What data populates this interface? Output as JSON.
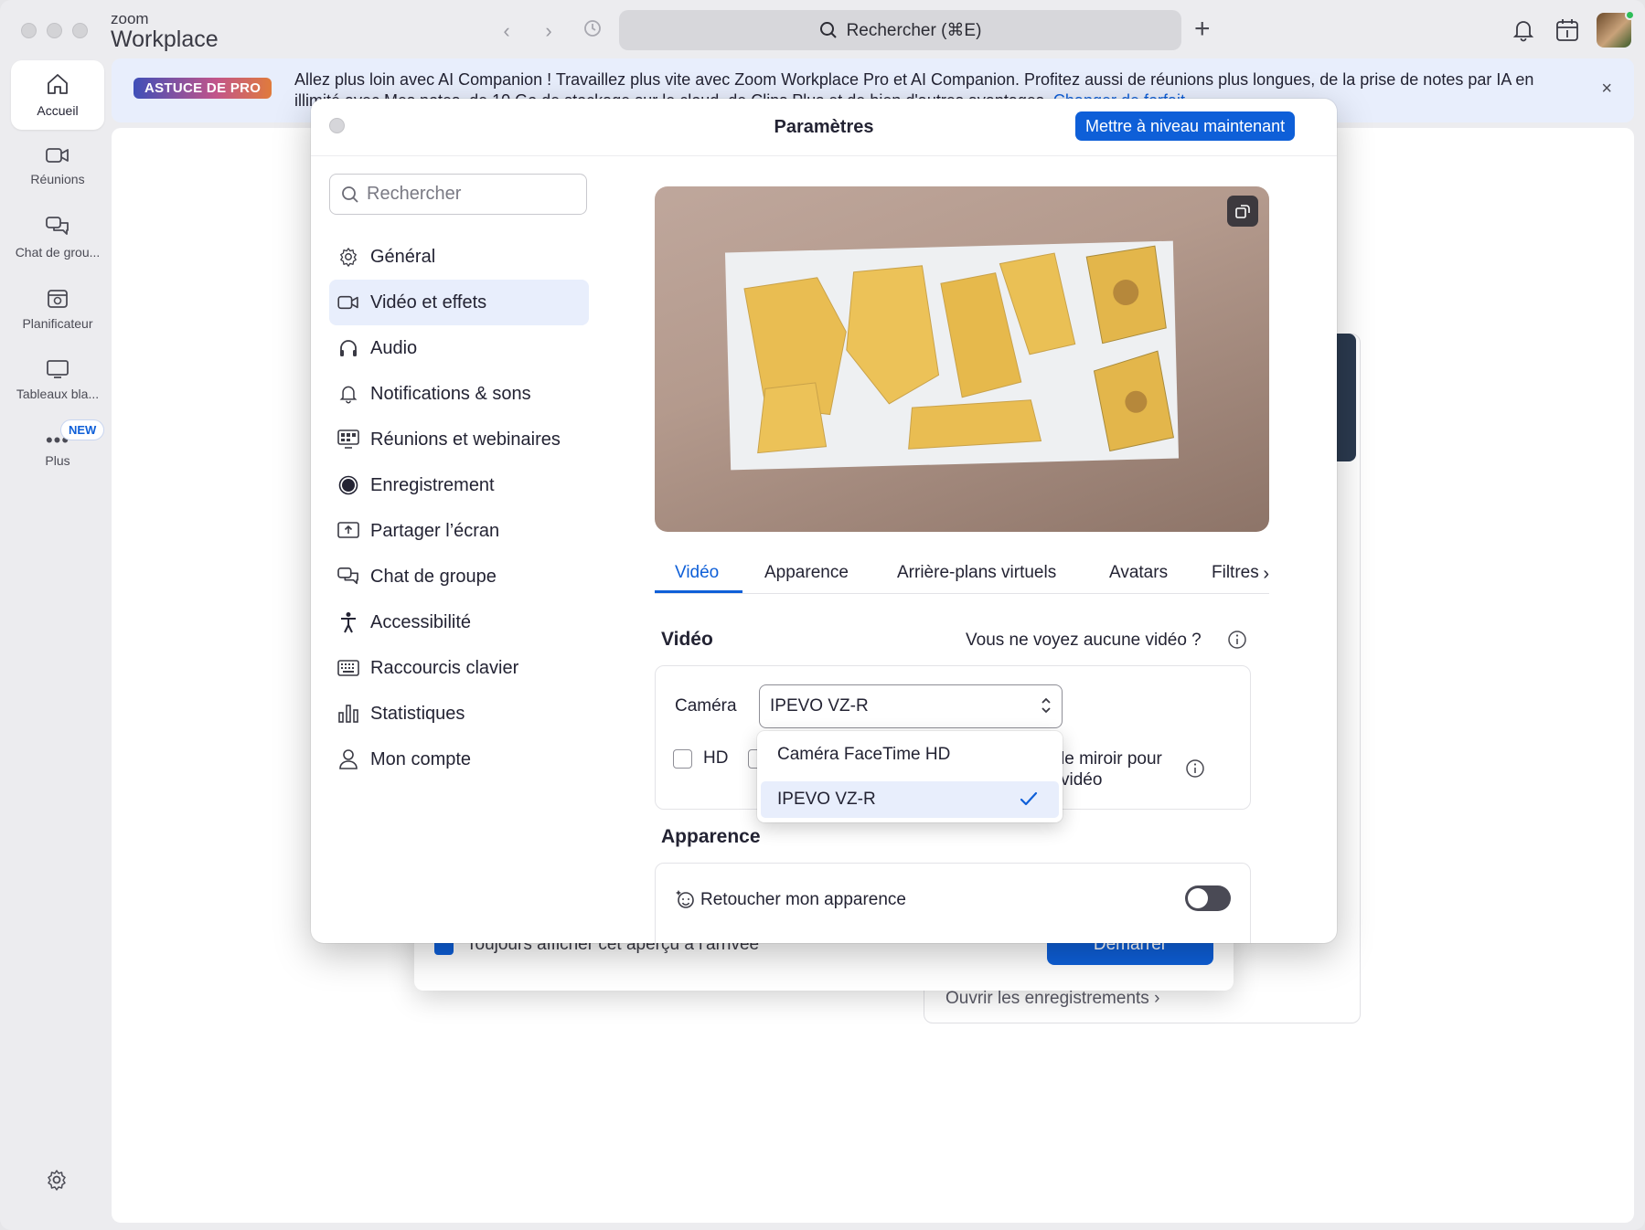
{
  "app": {
    "brand_small": "zoom",
    "brand_big": "Workplace",
    "search_label": "Rechercher (⌘E)"
  },
  "rail": {
    "items": [
      {
        "label": "Accueil",
        "icon": "home-icon"
      },
      {
        "label": "Réunions",
        "icon": "video-camera-icon"
      },
      {
        "label": "Chat de grou...",
        "icon": "chat-bubbles-icon"
      },
      {
        "label": "Planificateur",
        "icon": "calendar-icon"
      },
      {
        "label": "Tableaux bla...",
        "icon": "whiteboard-icon"
      },
      {
        "label": "Plus",
        "icon": "more-icon"
      }
    ],
    "new_badge": "NEW"
  },
  "banner": {
    "badge": "ASTUCE DE PRO",
    "text": "Allez plus loin avec AI Companion ! Travaillez plus vite avec Zoom Workplace Pro et AI Companion. Profitez aussi de réunions plus longues, de la prise de notes par IA en illimité avec Mes notes, de 10 Go de stockage sur le cloud, de Clips Plus et de bien d'autres avantages.",
    "link": "Changer de forfait",
    "close": "×"
  },
  "background": {
    "always_show_label": "Toujours afficher cet aperçu à l'arrivée",
    "start_button": "Démarrer",
    "open_recordings": "Ouvrir les enregistrements"
  },
  "settings": {
    "title": "Paramètres",
    "upgrade_button": "Mettre à niveau maintenant",
    "search_placeholder": "Rechercher",
    "menu": [
      {
        "label": "Général",
        "icon": "gear-icon"
      },
      {
        "label": "Vidéo et effets",
        "icon": "video-camera-icon"
      },
      {
        "label": "Audio",
        "icon": "headphones-icon"
      },
      {
        "label": "Notifications & sons",
        "icon": "bell-icon"
      },
      {
        "label": "Réunions et webinaires",
        "icon": "meetings-grid-icon"
      },
      {
        "label": "Enregistrement",
        "icon": "record-icon"
      },
      {
        "label": "Partager l’écran",
        "icon": "share-screen-icon"
      },
      {
        "label": "Chat de groupe",
        "icon": "chat-bubbles-icon"
      },
      {
        "label": "Accessibilité",
        "icon": "accessibility-icon"
      },
      {
        "label": "Raccourcis clavier",
        "icon": "keyboard-icon"
      },
      {
        "label": "Statistiques",
        "icon": "bar-chart-icon"
      },
      {
        "label": "Mon compte",
        "icon": "person-icon"
      }
    ],
    "active_menu": "Vidéo et effets",
    "tabs": [
      "Vidéo",
      "Apparence",
      "Arrière-plans virtuels",
      "Avatars",
      "Filtres"
    ],
    "active_tab": "Vidéo",
    "video_section_title": "Vidéo",
    "no_video_text": "Vous ne voyez aucune vidéo ?",
    "camera_label": "Caméra",
    "camera_selected": "IPEVO VZ-R",
    "camera_options": [
      "Caméra FaceTime HD",
      "IPEVO VZ-R"
    ],
    "hd_label": "HD",
    "mirror_label": "le miroir pour\nvidéo",
    "appearance_section_title": "Apparence",
    "retouch_label": "Retoucher mon apparence",
    "retouch_enabled": false
  },
  "colors": {
    "accent": "#0e5fd8",
    "selected_bg": "#e8eefc",
    "toggle_off": "#4a4a55"
  }
}
